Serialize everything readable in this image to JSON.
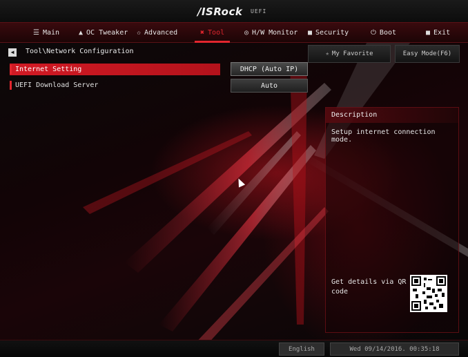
{
  "header": {
    "logo": "/ISRock",
    "logo_sub": "UEFI"
  },
  "menu": [
    {
      "label": "Main",
      "icon": "list-icon",
      "glyph": "☰",
      "active": false
    },
    {
      "label": "OC Tweaker",
      "icon": "rocket-icon",
      "glyph": "▲",
      "active": false
    },
    {
      "label": "Advanced",
      "icon": "star-icon",
      "glyph": "✩",
      "active": false
    },
    {
      "label": "Tool",
      "icon": "tool-icon",
      "glyph": "✖",
      "active": true
    },
    {
      "label": "H/W Monitor",
      "icon": "monitor-icon",
      "glyph": "◎",
      "active": false
    },
    {
      "label": "Security",
      "icon": "shield-icon",
      "glyph": "■",
      "active": false
    },
    {
      "label": "Boot",
      "icon": "power-icon",
      "glyph": "⏻",
      "active": false
    },
    {
      "label": "Exit",
      "icon": "exit-icon",
      "glyph": "■",
      "active": false
    }
  ],
  "breadcrumb": {
    "back_glyph": "◀",
    "path": "Tool\\Network Configuration"
  },
  "buttons": {
    "favorite": "My Favorite",
    "favorite_glyph": "★",
    "easy_mode": "Easy Mode(F6)"
  },
  "settings": [
    {
      "label": "Internet Setting",
      "value": "DHCP (Auto IP)"
    },
    {
      "label": "UEFI Download Server",
      "value": "Auto"
    }
  ],
  "description": {
    "title": "Description",
    "text": "Setup internet connection mode.",
    "qr_label": "Get details via QR code"
  },
  "footer": {
    "language": "English",
    "datetime": "Wed 09/14/2016. 00:35:18"
  },
  "colors": {
    "accent": "#e2262e",
    "panel": "#1c0506"
  }
}
